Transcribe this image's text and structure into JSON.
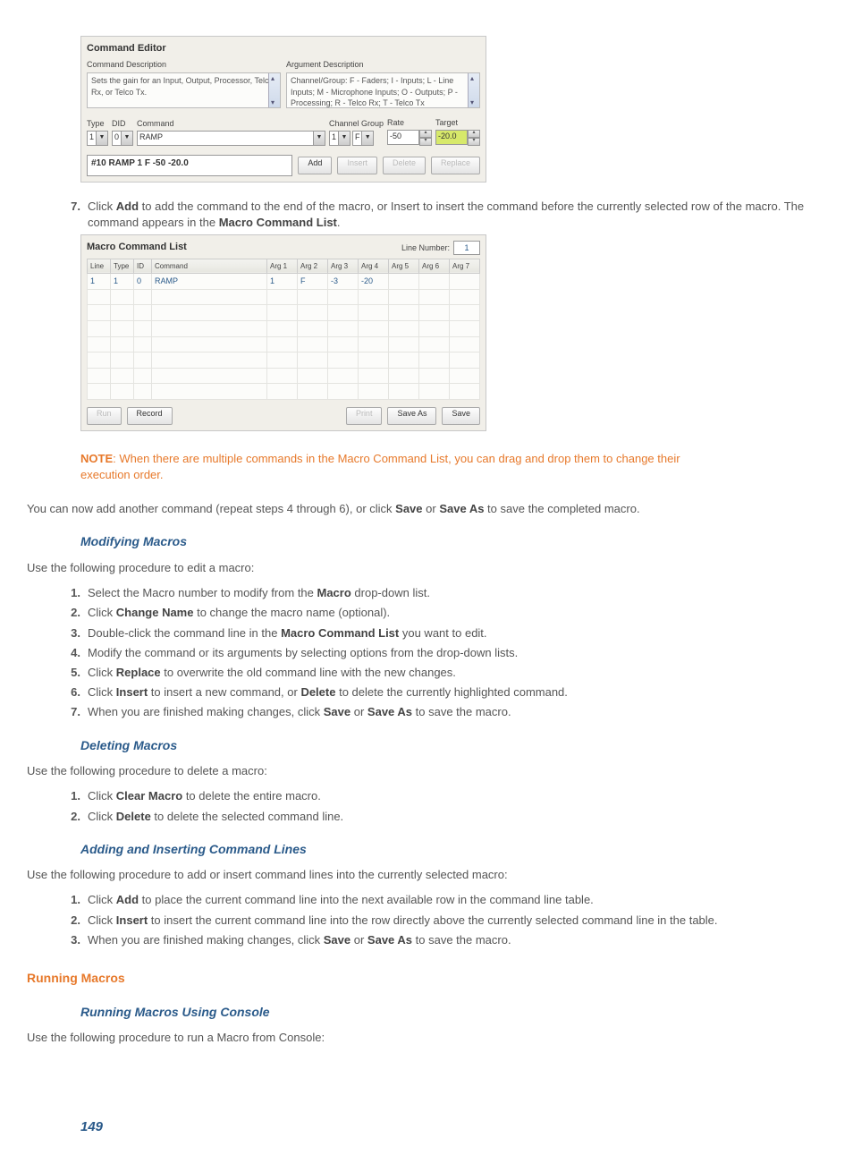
{
  "ce": {
    "title": "Command Editor",
    "cmd_desc_label": "Command Description",
    "cmd_desc_text": "Sets the gain for an Input, Output, Processor, Telco Rx, or Telco Tx.",
    "arg_desc_label": "Argument Description",
    "arg_desc_text": "Channel/Group: F - Faders; I - Inputs; L - Line Inputs; M - Microphone Inputs;  O - Outputs; P - Processing; R - Telco Rx; T - Telco Tx",
    "f_type": "Type",
    "f_type_v": "1",
    "f_did": "DID",
    "f_did_v": "0",
    "f_cmd": "Command",
    "f_cmd_v": "RAMP",
    "f_chgrp": "Channel Group",
    "f_ch_v": "1",
    "f_grp_v": "F",
    "f_rate": "Rate",
    "f_rate_v": "-50",
    "f_target": "Target",
    "f_target_v": "-20.0",
    "preview": "#10 RAMP 1 F -50 -20.0",
    "btn_add": "Add",
    "btn_insert": "Insert",
    "btn_delete": "Delete",
    "btn_replace": "Replace"
  },
  "step7": {
    "num": "7.",
    "p1a": "Click ",
    "p1b": "Add",
    "p1c": " to add the command to the end of the macro, or Insert to insert the command before the currently selected row of the macro. The command appears in the ",
    "p1d": "Macro Command List",
    "p1e": "."
  },
  "mcl": {
    "title": "Macro Command List",
    "ln_label": "Line Number:",
    "ln_value": "1",
    "cols": [
      "Line",
      "Type",
      "ID",
      "Command",
      "Arg 1",
      "Arg 2",
      "Arg 3",
      "Arg 4",
      "Arg 5",
      "Arg 6",
      "Arg 7"
    ],
    "row": [
      "1",
      "1",
      "0",
      "RAMP",
      "1",
      "F",
      "-3",
      "-20",
      "",
      "",
      ""
    ],
    "btn_run": "Run",
    "btn_record": "Record",
    "btn_print": "Print",
    "btn_saveas": "Save As",
    "btn_save": "Save"
  },
  "note": {
    "label": "NOTE",
    "text": ": When there are multiple commands in the Macro Command List, you can drag and drop them to change their execution order."
  },
  "after_note": {
    "a": "You can now add another command (repeat steps 4 through 6), or click ",
    "b": "Save",
    "c": " or ",
    "d": "Save As",
    "e": " to save the completed macro."
  },
  "mod": {
    "h": "Modifying Macros",
    "intro": "Use the following procedure to edit a macro:",
    "s1": {
      "n": "1.",
      "a": "Select the Macro number to modify from the ",
      "b": "Macro",
      "c": " drop-down list."
    },
    "s2": {
      "n": "2.",
      "a": "Click ",
      "b": "Change Name",
      "c": " to change the macro name (optional)."
    },
    "s3": {
      "n": "3.",
      "a": "Double-click the command line in the ",
      "b": "Macro Command List",
      "c": " you want to edit."
    },
    "s4": {
      "n": "4.",
      "a": "Modify the command or its arguments by selecting options from the drop-down lists."
    },
    "s5": {
      "n": "5.",
      "a": "Click ",
      "b": "Replace",
      "c": " to overwrite the old command line with the new changes."
    },
    "s6": {
      "n": "6.",
      "a": "Click ",
      "b": "Insert",
      "c": " to insert a new command, or ",
      "d": "Delete",
      "e": " to delete the currently highlighted command."
    },
    "s7": {
      "n": "7.",
      "a": "When you are finished making changes, click ",
      "b": "Save",
      "c": " or ",
      "d": "Save As",
      "e": " to save the macro."
    }
  },
  "del": {
    "h": "Deleting Macros",
    "intro": "Use the following procedure to delete a macro:",
    "s1": {
      "n": "1.",
      "a": "Click ",
      "b": "Clear Macro",
      "c": " to delete the entire macro."
    },
    "s2": {
      "n": "2.",
      "a": "Click ",
      "b": "Delete",
      "c": " to delete the selected command line."
    }
  },
  "add": {
    "h": "Adding and Inserting Command Lines",
    "intro": "Use the following procedure to add or insert command lines into the currently selected macro:",
    "s1": {
      "n": "1.",
      "a": "Click ",
      "b": "Add",
      "c": " to place the current command line into the next available row in the command line table."
    },
    "s2": {
      "n": "2.",
      "a": "Click ",
      "b": "Insert",
      "c": " to insert the current command line into the row directly above the currently selected command line in the table."
    },
    "s3": {
      "n": "3.",
      "a": "When you are finished making changes, click ",
      "b": "Save",
      "c": " or ",
      "d": "Save As",
      "e": " to save the macro."
    }
  },
  "run": {
    "h2": "Running Macros",
    "h3": "Running Macros Using Console",
    "intro": "Use the following procedure to run a Macro from Console:"
  },
  "page_num": "149"
}
